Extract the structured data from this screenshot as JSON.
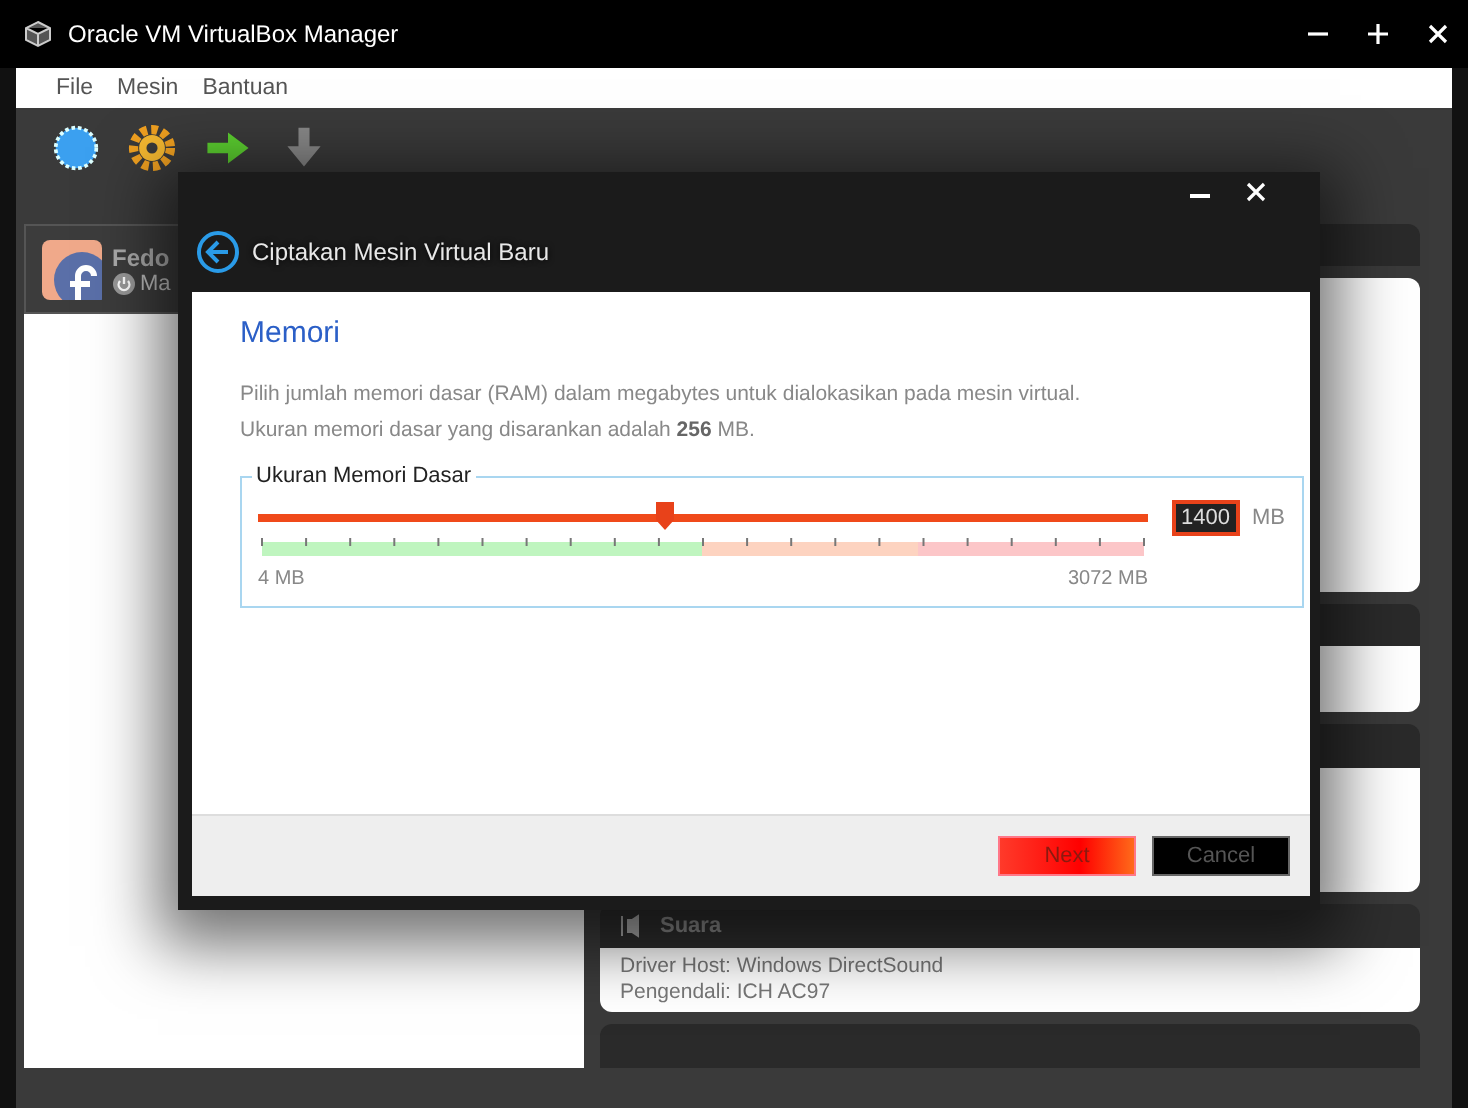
{
  "window": {
    "title": "Oracle VM VirtualBox Manager"
  },
  "menu": [
    "File",
    "Mesin",
    "Bantuan"
  ],
  "vm_list": [
    {
      "name": "Fedo",
      "state": "Ma",
      "selected": true
    }
  ],
  "details": {
    "sections": [
      {
        "title": "Suara",
        "lines": [
          "Driver Host: Windows DirectSound",
          "Pengendali:  ICH AC97"
        ]
      }
    ]
  },
  "dialog": {
    "title": "Ciptakan Mesin Virtual Baru",
    "heading": "Memori",
    "description": "Pilih jumlah memori dasar (RAM) dalam megabytes untuk dialokasikan pada mesin virtual.",
    "recommendation": "Ukuran memori dasar yang disarankan adalah **256** MB.",
    "group_label": "Ukuran Memori Dasar",
    "memory": {
      "level": 0.456,
      "value": "1400",
      "unit": "MB",
      "min_label": "4 MB",
      "max_label": "3072 MB"
    },
    "buttons": [
      {
        "label": "Next",
        "kind": "primary"
      },
      {
        "label": "Cancel",
        "kind": "secondary"
      }
    ]
  }
}
